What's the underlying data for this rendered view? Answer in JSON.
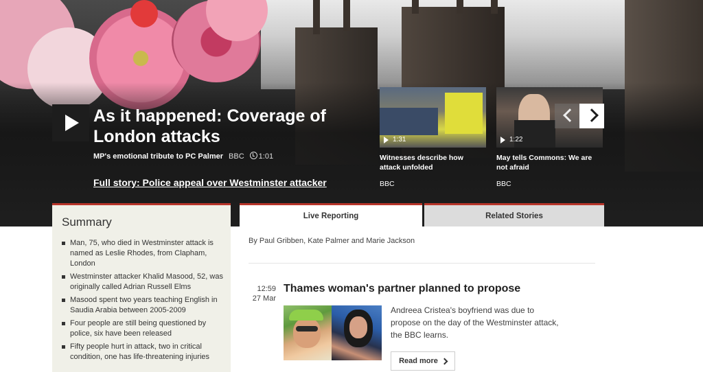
{
  "hero": {
    "title": "As it happened: Coverage of London attacks",
    "subtitle": "MP's emotional tribute to PC Palmer",
    "source": "BBC",
    "duration": "1:01",
    "full_story": "Full story: Police appeal over Westminster attacker"
  },
  "videos": [
    {
      "duration": "1:31",
      "title": "Witnesses describe how attack unfolded",
      "source": "BBC"
    },
    {
      "duration": "1:22",
      "title": "May tells Commons: We are not afraid",
      "source": "BBC"
    }
  ],
  "summary": {
    "title": "Summary",
    "items": [
      "Man, 75, who died in Westminster attack is named as Leslie Rhodes, from Clapham, London",
      "Westminster attacker Khalid Masood, 52, was originally called Adrian Russell Elms",
      "Masood spent two years teaching English in Saudia Arabia between 2005-2009",
      "Four people are still being questioned by police, six have been released",
      "Fifty people hurt in attack, two in critical condition, one has life-threatening injuries"
    ]
  },
  "tabs": {
    "live": "Live Reporting",
    "related": "Related Stories"
  },
  "byline": "By Paul Gribben, Kate Palmer and Marie Jackson",
  "post": {
    "time": "12:59",
    "date": "27 Mar",
    "title": "Thames woman's partner planned to propose",
    "text": "Andreea Cristea's boyfriend was due to propose on the day of the Westminster attack, the BBC learns.",
    "read_more": "Read more"
  },
  "colors": {
    "accent": "#b8352a",
    "hero_bg": "#1f1f1f",
    "summary_bg": "#f0f0e8"
  }
}
